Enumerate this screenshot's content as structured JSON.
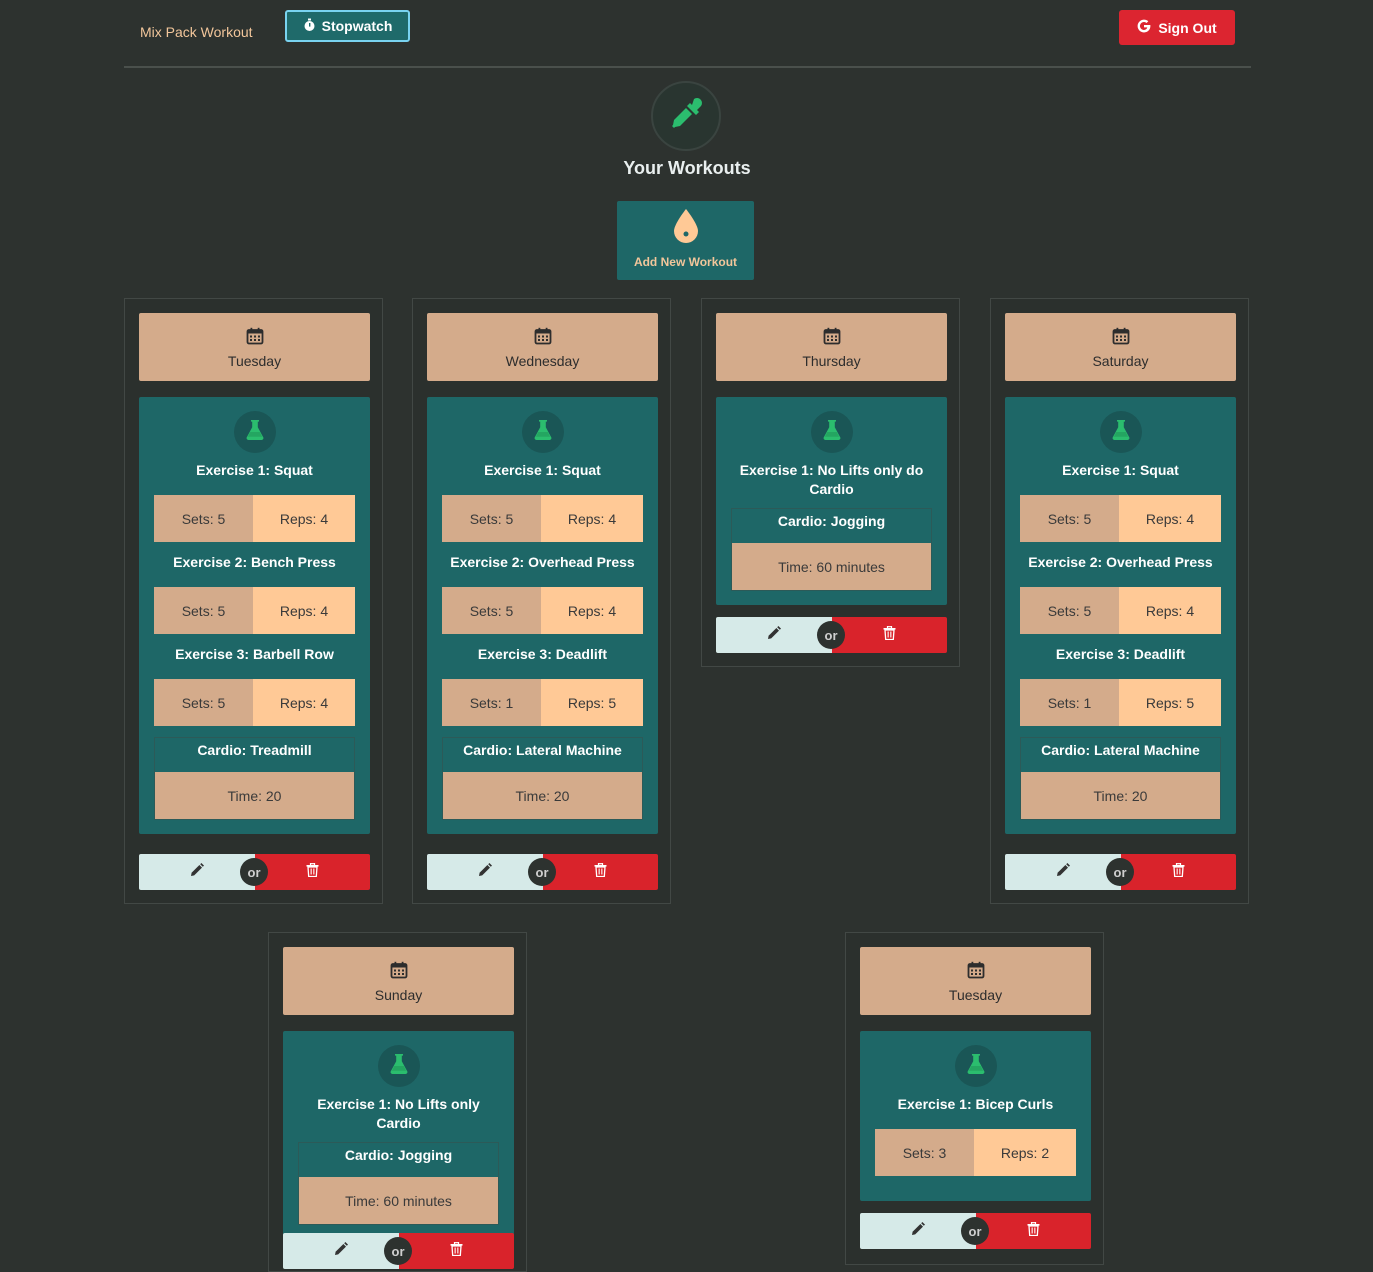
{
  "nav": {
    "brand": "Mix Pack Workout",
    "stopwatch_label": "Stopwatch",
    "signout_label": "Sign Out"
  },
  "header": {
    "title": "Your Workouts",
    "add_label": "Add New Workout"
  },
  "colors": {
    "background": "#2d322f",
    "teal": "#1e6767",
    "tan": "#d4ab8b",
    "peach": "#ffc996",
    "red": "#d9232b",
    "green_icon": "#2bbd6e"
  },
  "or_label": "or",
  "cards": [
    {
      "day": "Tuesday",
      "exercises": [
        {
          "title": "Exercise 1: Squat",
          "sets": "Sets: 5",
          "reps": "Reps: 4"
        },
        {
          "title": "Exercise 2: Bench Press",
          "sets": "Sets: 5",
          "reps": "Reps: 4"
        },
        {
          "title": "Exercise 3: Barbell Row",
          "sets": "Sets: 5",
          "reps": "Reps: 4"
        }
      ],
      "cardio": "Cardio: Treadmill",
      "time": "Time: 20"
    },
    {
      "day": "Wednesday",
      "exercises": [
        {
          "title": "Exercise 1: Squat",
          "sets": "Sets: 5",
          "reps": "Reps: 4"
        },
        {
          "title": "Exercise 2: Overhead Press",
          "sets": "Sets: 5",
          "reps": "Reps: 4"
        },
        {
          "title": "Exercise 3: Deadlift",
          "sets": "Sets: 1",
          "reps": "Reps: 5"
        }
      ],
      "cardio": "Cardio: Lateral Machine",
      "time": "Time: 20"
    },
    {
      "day": "Thursday",
      "exercises": [
        {
          "title": "Exercise 1: No Lifts only do Cardio"
        }
      ],
      "cardio": "Cardio: Jogging",
      "time": "Time: 60 minutes"
    },
    {
      "day": "Saturday",
      "exercises": [
        {
          "title": "Exercise 1: Squat",
          "sets": "Sets: 5",
          "reps": "Reps: 4"
        },
        {
          "title": "Exercise 2: Overhead Press",
          "sets": "Sets: 5",
          "reps": "Reps: 4"
        },
        {
          "title": "Exercise 3: Deadlift",
          "sets": "Sets: 1",
          "reps": "Reps: 5"
        }
      ],
      "cardio": "Cardio: Lateral Machine",
      "time": "Time: 20"
    },
    {
      "day": "Sunday",
      "exercises": [
        {
          "title": "Exercise 1: No Lifts only Cardio"
        }
      ],
      "cardio": "Cardio: Jogging",
      "time": "Time: 60 minutes"
    },
    {
      "day": "Tuesday",
      "exercises": [
        {
          "title": "Exercise 1: Bicep Curls",
          "sets": "Sets: 3",
          "reps": "Reps: 2"
        }
      ]
    }
  ]
}
